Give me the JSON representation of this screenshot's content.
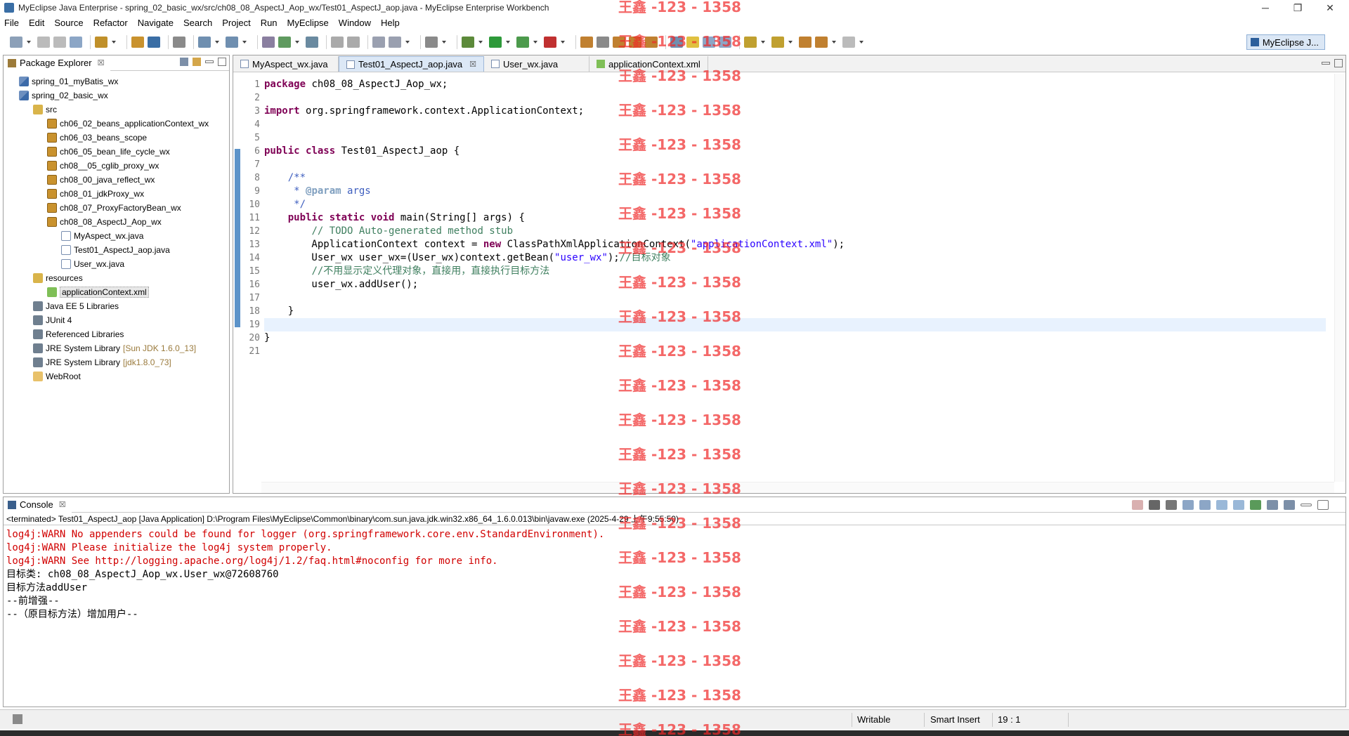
{
  "window": {
    "title": "MyEclipse Java Enterprise - spring_02_basic_wx/src/ch08_08_AspectJ_Aop_wx/Test01_AspectJ_aop.java - MyEclipse Enterprise Workbench",
    "minimize": "─",
    "maximize": "❐",
    "close": "✕"
  },
  "menu": [
    "File",
    "Edit",
    "Source",
    "Refactor",
    "Navigate",
    "Search",
    "Project",
    "Run",
    "MyEclipse",
    "Window",
    "Help"
  ],
  "perspective": {
    "label": "MyEclipse J..."
  },
  "package_explorer": {
    "title": "Package Explorer",
    "close": "☒",
    "items": [
      {
        "label": "spring_01_myBatis_wx",
        "icon": "project-icon",
        "depth": 0,
        "decor": ""
      },
      {
        "label": "spring_02_basic_wx",
        "icon": "project-icon",
        "depth": 0,
        "decor": ""
      },
      {
        "label": "src",
        "icon": "source-folder-icon",
        "depth": 1,
        "decor": ""
      },
      {
        "label": "ch06_02_beans_applicationContext_wx",
        "icon": "package-icon",
        "depth": 2,
        "decor": ""
      },
      {
        "label": "ch06_03_beans_scope",
        "icon": "package-icon",
        "depth": 2,
        "decor": ""
      },
      {
        "label": "ch06_05_bean_life_cycle_wx",
        "icon": "package-icon",
        "depth": 2,
        "decor": ""
      },
      {
        "label": "ch08__05_cglib_proxy_wx",
        "icon": "package-icon",
        "depth": 2,
        "decor": ""
      },
      {
        "label": "ch08_00_java_reflect_wx",
        "icon": "package-icon",
        "depth": 2,
        "decor": ""
      },
      {
        "label": "ch08_01_jdkProxy_wx",
        "icon": "package-icon",
        "depth": 2,
        "decor": ""
      },
      {
        "label": "ch08_07_ProxyFactoryBean_wx",
        "icon": "package-icon",
        "depth": 2,
        "decor": ""
      },
      {
        "label": "ch08_08_AspectJ_Aop_wx",
        "icon": "package-icon",
        "depth": 2,
        "decor": ""
      },
      {
        "label": "MyAspect_wx.java",
        "icon": "java-file-icon",
        "depth": 3,
        "decor": ""
      },
      {
        "label": "Test01_AspectJ_aop.java",
        "icon": "java-file-icon",
        "depth": 3,
        "decor": ""
      },
      {
        "label": "User_wx.java",
        "icon": "java-file-icon",
        "depth": 3,
        "decor": ""
      },
      {
        "label": "resources",
        "icon": "source-folder-icon",
        "depth": 1,
        "decor": ""
      },
      {
        "label": "applicationContext.xml",
        "icon": "xml-file-icon",
        "depth": 2,
        "decor": "",
        "selected": true
      },
      {
        "label": "Java EE 5 Libraries",
        "icon": "library-icon",
        "depth": 1,
        "decor": ""
      },
      {
        "label": "JUnit 4",
        "icon": "library-icon",
        "depth": 1,
        "decor": ""
      },
      {
        "label": "Referenced Libraries",
        "icon": "library-icon",
        "depth": 1,
        "decor": ""
      },
      {
        "label": "JRE System Library",
        "icon": "library-icon",
        "depth": 1,
        "decor": "[Sun JDK 1.6.0_13]"
      },
      {
        "label": "JRE System Library",
        "icon": "library-icon",
        "depth": 1,
        "decor": "[jdk1.8.0_73]"
      },
      {
        "label": "WebRoot",
        "icon": "folder-icon",
        "depth": 1,
        "decor": ""
      }
    ]
  },
  "editor": {
    "tabs": [
      {
        "label": "MyAspect_wx.java",
        "icon": "java-file-icon",
        "active": false
      },
      {
        "label": "Test01_AspectJ_aop.java",
        "icon": "java-file-icon",
        "active": true
      },
      {
        "label": "User_wx.java",
        "icon": "java-file-icon",
        "active": false
      },
      {
        "label": "applicationContext.xml",
        "icon": "xml-file-icon",
        "active": false
      }
    ],
    "tab_close": "☒",
    "current_line": 19,
    "lines": [
      [
        {
          "t": "kw",
          "v": "package"
        },
        {
          "t": "",
          "v": " ch08_08_AspectJ_Aop_wx;"
        }
      ],
      [],
      [
        {
          "t": "kw",
          "v": "import"
        },
        {
          "t": "",
          "v": " org.springframework.context.ApplicationContext;"
        }
      ],
      [],
      [],
      [
        {
          "t": "kw",
          "v": "public"
        },
        {
          "t": "",
          "v": " "
        },
        {
          "t": "kw",
          "v": "class"
        },
        {
          "t": "",
          "v": " Test01_AspectJ_aop {"
        }
      ],
      [],
      [
        {
          "t": "",
          "v": "    "
        },
        {
          "t": "jd",
          "v": "/**"
        }
      ],
      [
        {
          "t": "",
          "v": "     "
        },
        {
          "t": "jd",
          "v": "* "
        },
        {
          "t": "ann",
          "v": "@param"
        },
        {
          "t": "jd",
          "v": " args"
        }
      ],
      [
        {
          "t": "",
          "v": "     "
        },
        {
          "t": "jd",
          "v": "*/"
        }
      ],
      [
        {
          "t": "",
          "v": "    "
        },
        {
          "t": "kw",
          "v": "public"
        },
        {
          "t": "",
          "v": " "
        },
        {
          "t": "kw",
          "v": "static"
        },
        {
          "t": "",
          "v": " "
        },
        {
          "t": "kw",
          "v": "void"
        },
        {
          "t": "",
          "v": " main(String[] args) {"
        }
      ],
      [
        {
          "t": "",
          "v": "        "
        },
        {
          "t": "cm",
          "v": "// TODO Auto-generated method stub"
        }
      ],
      [
        {
          "t": "",
          "v": "        ApplicationContext context = "
        },
        {
          "t": "kw",
          "v": "new"
        },
        {
          "t": "",
          "v": " ClassPathXmlApplicationContext("
        },
        {
          "t": "st",
          "v": "\"applicationContext.xml\""
        },
        {
          "t": "",
          "v": ");"
        }
      ],
      [
        {
          "t": "",
          "v": "        User_wx user_wx=(User_wx)context.getBean("
        },
        {
          "t": "st",
          "v": "\"user_wx\""
        },
        {
          "t": "",
          "v": ");"
        },
        {
          "t": "cm",
          "v": "//目标对象"
        }
      ],
      [
        {
          "t": "",
          "v": "        "
        },
        {
          "t": "cm",
          "v": "//不用显示定义代理对象，直接用，直接执行目标方法"
        }
      ],
      [
        {
          "t": "",
          "v": "        user_wx.addUser();"
        }
      ],
      [],
      [
        {
          "t": "",
          "v": "    }"
        }
      ],
      [],
      [
        {
          "t": "",
          "v": "}"
        }
      ],
      []
    ]
  },
  "console": {
    "title": "Console",
    "close": "☒",
    "info": "<terminated> Test01_AspectJ_aop [Java Application] D:\\Program Files\\MyEclipse\\Common\\binary\\com.sun.java.jdk.win32.x86_64_1.6.0.013\\bin\\javaw.exe (2025-4-29 上午9:55:50)",
    "output": [
      {
        "text": "log4j:WARN No appenders could be found for logger (org.springframework.core.env.StandardEnvironment).",
        "err": true
      },
      {
        "text": "log4j:WARN Please initialize the log4j system properly.",
        "err": true
      },
      {
        "text": "log4j:WARN See http://logging.apache.org/log4j/1.2/faq.html#noconfig for more info.",
        "err": true
      },
      {
        "text": "目标类: ch08_08_AspectJ_Aop_wx.User_wx@72608760",
        "err": false
      },
      {
        "text": "目标方法addUser",
        "err": false
      },
      {
        "text": "--前增强--",
        "err": false
      },
      {
        "text": "--（原目标方法）增加用户--",
        "err": false
      }
    ]
  },
  "status": {
    "writable": "Writable",
    "insert_mode": "Smart Insert",
    "position": "19 : 1"
  },
  "watermark": "王鑫 -123 - 1358"
}
